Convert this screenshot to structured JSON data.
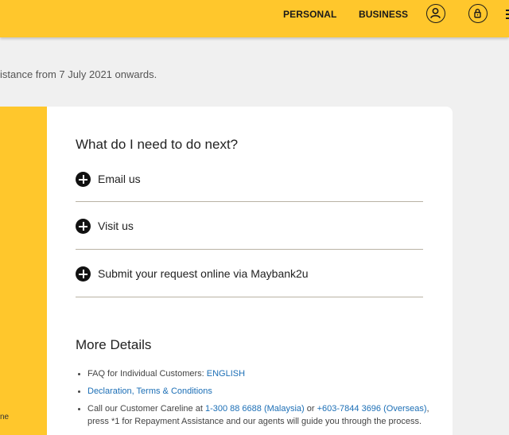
{
  "header": {
    "nav": {
      "personal": "PERSONAL",
      "business": "BUSINESS"
    },
    "icons": [
      "user-account-icon",
      "lock-icon",
      "menu-icon"
    ],
    "background_color": "#ffc72c"
  },
  "intro": {
    "text": "istance from 7 July 2021 onwards."
  },
  "side_panel": {
    "fragment": "ne"
  },
  "next_steps": {
    "title": "What do I need to do next?",
    "items": [
      {
        "label": "Email us"
      },
      {
        "label": "Visit us"
      },
      {
        "label": "Submit your request online via Maybank2u"
      }
    ]
  },
  "more_details": {
    "title": "More Details",
    "faq_prefix": "FAQ for Individual Customers: ",
    "faq_link": "ENGLISH",
    "declaration_link": "Declaration, Terms & Conditions",
    "call_prefix": "Call our Customer Careline at ",
    "phone_malaysia": "1-300 88 6688 (Malaysia)",
    "call_or": " or ",
    "phone_overseas": "+603-7844 3696 (Overseas)",
    "call_suffix": ", press *1 for Repayment Assistance and our agents will guide you through the process."
  },
  "colors": {
    "accent": "#ffc72c",
    "link": "#1c6fb6"
  }
}
